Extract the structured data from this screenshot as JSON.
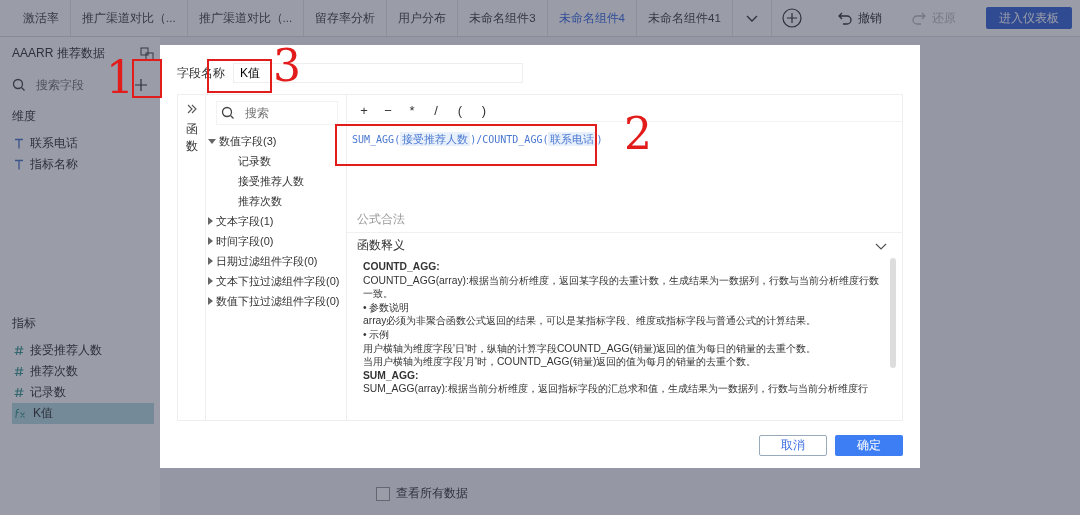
{
  "top_bar": {
    "tabs": [
      {
        "label": "激活率",
        "selected": false
      },
      {
        "label": "推广渠道对比（...",
        "selected": false
      },
      {
        "label": "推广渠道对比（...",
        "selected": false
      },
      {
        "label": "留存率分析",
        "selected": false
      },
      {
        "label": "用户分布",
        "selected": false
      },
      {
        "label": "未命名组件3",
        "selected": false
      },
      {
        "label": "未命名组件4",
        "selected": true
      },
      {
        "label": "未命名组件41",
        "selected": false
      }
    ],
    "undo": {
      "label": "撤销",
      "disabled": false
    },
    "redo": {
      "label": "还原",
      "disabled": true
    },
    "enter_button": "进入仪表板"
  },
  "sidebar": {
    "title": "AAARR 推荐数据",
    "search": {
      "placeholder": "搜索字段"
    },
    "sections": [
      {
        "title": "维度",
        "items": [
          {
            "label": "联系电话",
            "kind": "text",
            "selected": false
          },
          {
            "label": "指标名称",
            "kind": "text",
            "selected": false
          }
        ]
      },
      {
        "title": "指标",
        "items": [
          {
            "label": "接受推荐人数",
            "kind": "number",
            "selected": false
          },
          {
            "label": "推荐次数",
            "kind": "number",
            "selected": false
          },
          {
            "label": "记录数",
            "kind": "number",
            "selected": false
          },
          {
            "label": "K值",
            "kind": "formula",
            "selected": true
          }
        ]
      }
    ]
  },
  "main": {
    "show_all": {
      "label": "查看所有数据",
      "checked": false
    }
  },
  "dialog": {
    "field_name": {
      "label": "字段名称",
      "value": "K值"
    },
    "function_tab": "函数",
    "tree_search": {
      "placeholder": "搜索"
    },
    "tree": [
      {
        "label": "数值字段(3)",
        "expanded": true,
        "children": [
          {
            "label": "记录数"
          },
          {
            "label": "接受推荐人数"
          },
          {
            "label": "推荐次数"
          }
        ]
      },
      {
        "label": "文本字段(1)",
        "expanded": false
      },
      {
        "label": "时间字段(0)",
        "expanded": false
      },
      {
        "label": "日期过滤组件字段(0)",
        "expanded": false
      },
      {
        "label": "文本下拉过滤组件字段(0)",
        "expanded": false
      },
      {
        "label": "数值下拉过滤组件字段(0)",
        "expanded": false
      }
    ],
    "operators": [
      "+",
      "−",
      "*",
      "/",
      "(",
      ")"
    ],
    "formula": [
      {
        "kind": "code",
        "text": "SUM_AGG("
      },
      {
        "kind": "field",
        "text": "接受推荐人数"
      },
      {
        "kind": "code",
        "text": ")/COUNTD_AGG("
      },
      {
        "kind": "field",
        "text": "联系电话"
      },
      {
        "kind": "code",
        "text": ")"
      }
    ],
    "status": "公式合法",
    "help": {
      "title": "函数释义",
      "expanded": true,
      "lines": [
        {
          "kind": "heading",
          "text": "COUNTD_AGG:"
        },
        {
          "kind": "text",
          "text": "COUNTD_AGG(array):根据当前分析维度，返回某字段的去重计数，生成结果为一数据列，行数与当前分析维度行数一致。"
        },
        {
          "kind": "text",
          "text": "• 参数说明"
        },
        {
          "kind": "text",
          "text": "array必须为非聚合函数公式返回的结果，可以是某指标字段、维度或指标字段与普通公式的计算结果。"
        },
        {
          "kind": "text",
          "text": "• 示例"
        },
        {
          "kind": "text",
          "text": "用户横轴为维度字段'日'时，纵轴的计算字段COUNTD_AGG(销量)返回的值为每日的销量的去重个数。"
        },
        {
          "kind": "text",
          "text": "当用户横轴为维度字段'月'时，COUNTD_AGG(销量)返回的值为每月的销量的去重个数。"
        },
        {
          "kind": "heading",
          "text": "SUM_AGG:"
        },
        {
          "kind": "text",
          "text": "SUM_AGG(array):根据当前分析维度，返回指标字段的汇总求和值，生成结果为一数据列，行数与当前分析维度行"
        }
      ]
    },
    "cancel": "取消",
    "ok": "确定"
  },
  "annotations": [
    {
      "label": "1"
    },
    {
      "label": "3"
    },
    {
      "label": "2"
    }
  ]
}
